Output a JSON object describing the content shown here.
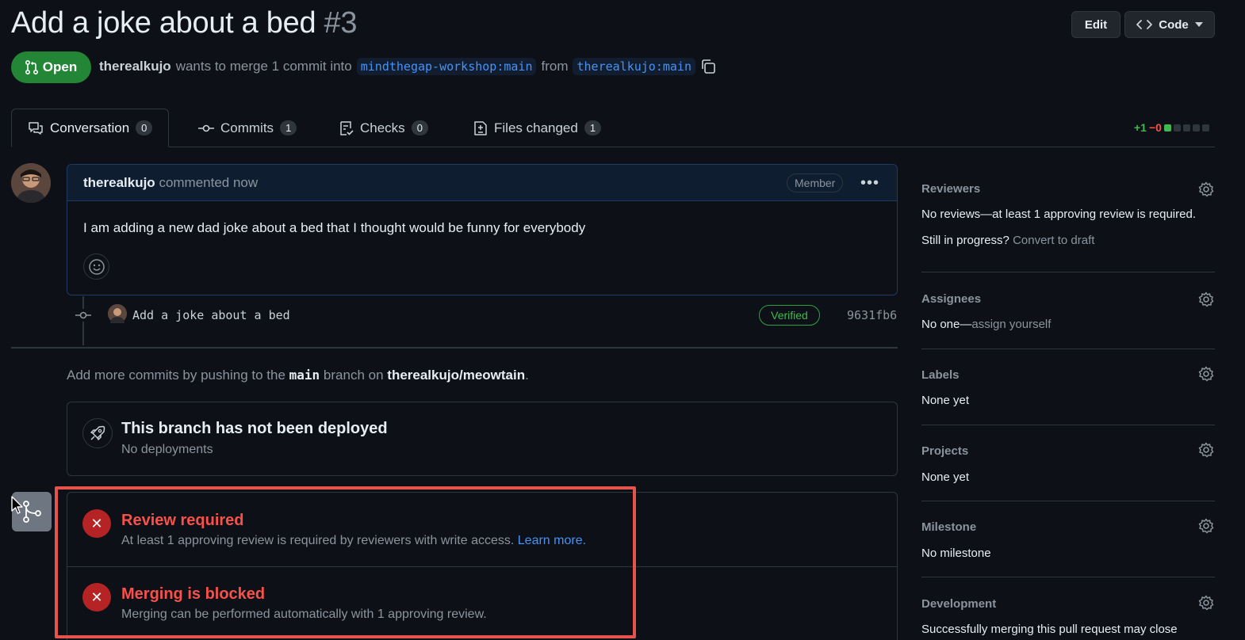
{
  "header": {
    "title": "Add a joke about a bed",
    "number": "#3",
    "edit_label": "Edit",
    "code_label": "Code"
  },
  "pr_meta": {
    "state": "Open",
    "author": "therealkujo",
    "action_text": "wants to merge 1 commit into",
    "base_branch": "mindthegap-workshop:main",
    "from_text": "from",
    "head_branch": "therealkujo:main"
  },
  "tabs": [
    {
      "label": "Conversation",
      "count": "0"
    },
    {
      "label": "Commits",
      "count": "1"
    },
    {
      "label": "Checks",
      "count": "0"
    },
    {
      "label": "Files changed",
      "count": "1"
    }
  ],
  "diffstat": {
    "added": "+1",
    "removed": "−0"
  },
  "comment": {
    "author": "therealkujo",
    "time_text": "commented now",
    "role_badge": "Member",
    "body": "I am adding a new dad joke about a bed that I thought would be funny for everybody"
  },
  "commit": {
    "message": "Add a joke about a bed",
    "verified_label": "Verified",
    "sha": "9631fb6"
  },
  "push_hint": {
    "prefix": "Add more commits by pushing to the",
    "branch": "main",
    "middle": "branch on",
    "repo": "therealkujo/meowtain",
    "suffix": "."
  },
  "deployment": {
    "title": "This branch has not been deployed",
    "subtitle": "No deployments"
  },
  "merge_checks": [
    {
      "title": "Review required",
      "text": "At least 1 approving review is required by reviewers with write access.",
      "link": "Learn more."
    },
    {
      "title": "Merging is blocked",
      "text": "Merging can be performed automatically with 1 approving review."
    }
  ],
  "sidebar": {
    "reviewers": {
      "title": "Reviewers",
      "value": "No reviews—at least 1 approving review is required.",
      "draft_prefix": "Still in progress?",
      "draft_link": "Convert to draft"
    },
    "assignees": {
      "title": "Assignees",
      "value_prefix": "No one—",
      "value_link": "assign yourself"
    },
    "labels": {
      "title": "Labels",
      "value": "None yet"
    },
    "projects": {
      "title": "Projects",
      "value": "None yet"
    },
    "milestone": {
      "title": "Milestone",
      "value": "No milestone"
    },
    "development": {
      "title": "Development",
      "value": "Successfully merging this pull request may close"
    }
  },
  "colors": {
    "background": "#0d1117",
    "open_green": "#238636",
    "link_blue": "#4493f8",
    "danger_red": "#f85149",
    "highlight_border": "#e5534b"
  }
}
